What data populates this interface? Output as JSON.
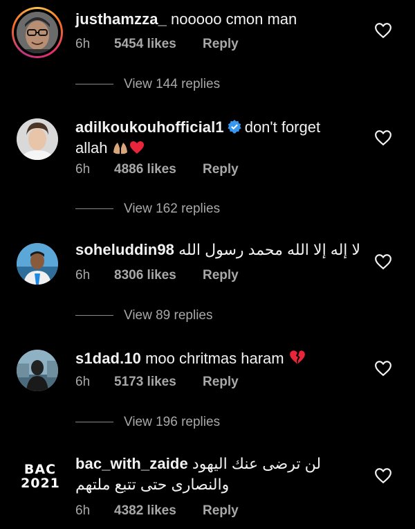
{
  "comments": [
    {
      "username": "justhamzza_",
      "text": "nooooo cmon man",
      "time": "6h",
      "likes": "5454 likes",
      "reply_label": "Reply",
      "view_replies": "View 144 replies",
      "avatar_icon": "person-with-glasses-avatar"
    },
    {
      "username": "adilkoukouhofficial1",
      "text_line1": "don't forget",
      "text_line2": "allah",
      "time": "6h",
      "likes": "4886 likes",
      "reply_label": "Reply",
      "view_replies": "View 162 replies",
      "avatar_icon": "person-avatar",
      "verified_icon": "verified-badge-icon"
    },
    {
      "username": "soheluddin98",
      "text": "لا إله إلا الله محمد رسول الله",
      "time": "6h",
      "likes": "8306 likes",
      "reply_label": "Reply",
      "view_replies": "View 89 replies",
      "avatar_icon": "person-avatar"
    },
    {
      "username": "s1dad.10",
      "text": "moo chritmas haram",
      "time": "6h",
      "likes": "5173 likes",
      "reply_label": "Reply",
      "view_replies": "View 196 replies",
      "avatar_icon": "person-avatar"
    },
    {
      "username": "bac_with_zaide",
      "text_line1": "لن ترضى عنك اليهود",
      "text_line2": "والنصارى حتى تتبع ملتهم",
      "time": "6h",
      "likes": "4382 likes",
      "reply_label": "Reply",
      "avatar_text_line1": "BAC",
      "avatar_text_line2": "2021"
    }
  ],
  "colors": {
    "background": "#000000",
    "text": "#f2f2f2",
    "secondary_text": "#a8a8a8",
    "verified": "#3897f0",
    "red_heart": "#e8253a"
  }
}
